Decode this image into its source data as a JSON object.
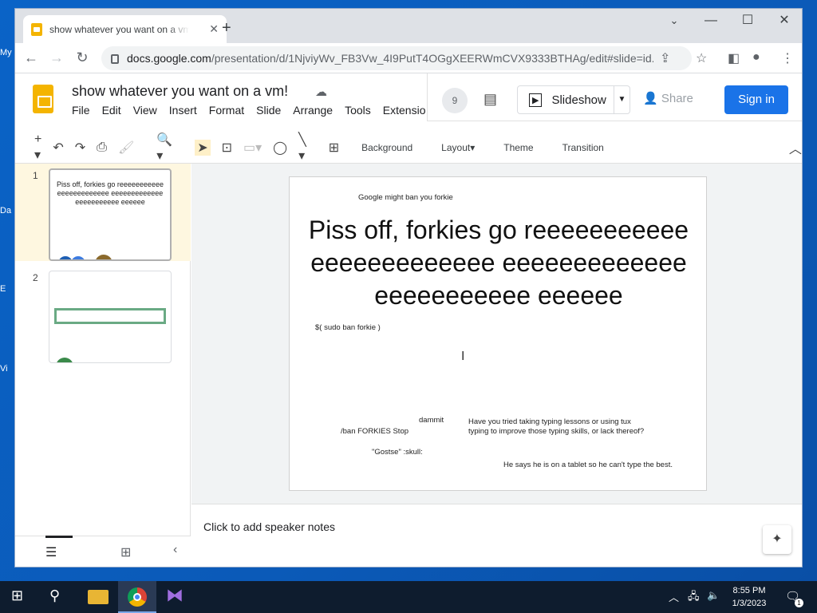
{
  "desktop": {
    "icons": [
      "My",
      "Da",
      "E",
      "Vi"
    ]
  },
  "browser": {
    "tab_title": "show whatever you want on a vm",
    "url_main": "docs.google.com",
    "url_path": "/presentation/d/1NjviyWv_FB3Vw_4I9PutT4OGgXEERWmCVX9333BTHAg/edit#slide=id.g..."
  },
  "docs": {
    "title": "show whatever you want on a vm!",
    "menu": [
      "File",
      "Edit",
      "View",
      "Insert",
      "Format",
      "Slide",
      "Arrange",
      "Tools",
      "Extensio"
    ],
    "users_count": "9",
    "slideshow_label": "Slideshow",
    "share_label": "Share",
    "signin_label": "Sign in",
    "toolbar_text": {
      "background": "Background",
      "layout": "Layout",
      "theme": "Theme",
      "transition": "Transition"
    }
  },
  "filmstrip": {
    "slides": [
      "1",
      "2"
    ]
  },
  "slide": {
    "top_note": "Google might ban you forkie",
    "title": "Piss off, forkies go reeeeeeeeeeeeeeeeeeeeeeee eeeeeeeeeeeeeeeeeeeeeeee eeeeee",
    "sudo": "$( sudo ban forkie )",
    "dammit": "dammit",
    "ban": "/ban FORKIES Stop",
    "typing1": "Have you tried taking typing lessons or using tux",
    "typing2": "typing to improve those typing skills, or lack thereof?",
    "gostse": "\"Gostse\" :skull:",
    "tablet": "He says he is on a tablet so he can't type the best."
  },
  "notes": {
    "placeholder": "Click to add speaker notes"
  },
  "taskbar": {
    "time": "8:55 PM",
    "date": "1/3/2023",
    "notification_count": "1"
  }
}
